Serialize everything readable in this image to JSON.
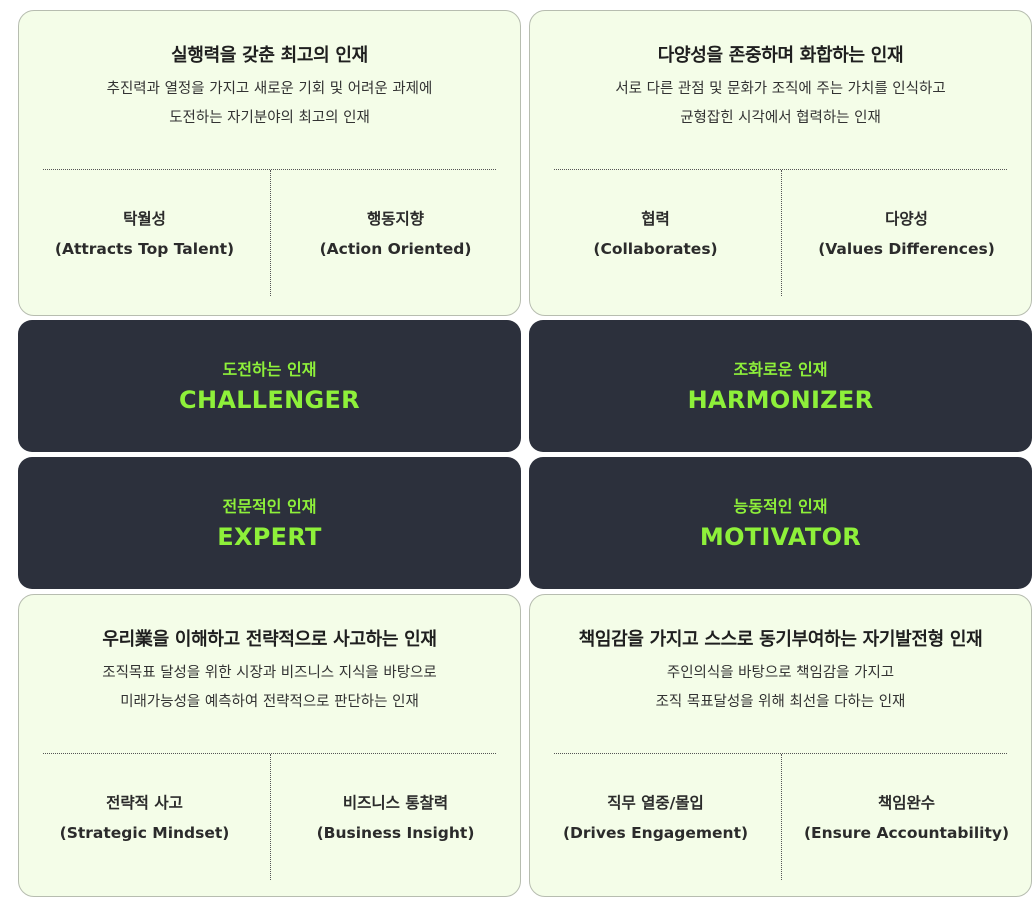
{
  "colors": {
    "card_background": "#f4fde8",
    "band_background": "#2c303c",
    "band_text": "#8ef03a"
  },
  "cards": [
    {
      "title": "실행력을 갖춘 최고의 인재",
      "desc_line1": "추진력과 열정을 가지고 새로운 기회 및 어려운 과제에",
      "desc_line2": "도전하는 자기분야의 최고의 인재",
      "left": {
        "ko": "탁월성",
        "en": "(Attracts Top Talent)"
      },
      "right": {
        "ko": "행동지향",
        "en": "(Action Oriented)"
      }
    },
    {
      "title": "다양성을 존중하며 화합하는 인재",
      "desc_line1": "서로 다른 관점 및 문화가 조직에 주는 가치를 인식하고",
      "desc_line2": "균형잡힌 시각에서 협력하는 인재",
      "left": {
        "ko": "협력",
        "en": "(Collaborates)"
      },
      "right": {
        "ko": "다양성",
        "en": "(Values Differences)"
      }
    },
    {
      "title": "우리業을 이해하고 전략적으로 사고하는 인재",
      "desc_line1": "조직목표 달성을 위한 시장과 비즈니스 지식을 바탕으로",
      "desc_line2": "미래가능성을 예측하여 전략적으로 판단하는 인재",
      "left": {
        "ko": "전략적 사고",
        "en": "(Strategic Mindset)"
      },
      "right": {
        "ko": "비즈니스 통찰력",
        "en": "(Business Insight)"
      }
    },
    {
      "title": "책임감을 가지고 스스로 동기부여하는 자기발전형 인재",
      "desc_line1": "주인의식을 바탕으로 책임감을 가지고",
      "desc_line2": "조직 목표달성을 위해 최선을 다하는 인재",
      "left": {
        "ko": "직무 열중/몰입",
        "en": "(Drives Engagement)"
      },
      "right": {
        "ko": "책임완수",
        "en": "(Ensure Accountability)"
      }
    }
  ],
  "bands": [
    {
      "ko": "도전하는 인재",
      "en": "CHALLENGER"
    },
    {
      "ko": "조화로운 인재",
      "en": "HARMONIZER"
    },
    {
      "ko": "전문적인 인재",
      "en": "EXPERT"
    },
    {
      "ko": "능동적인 인재",
      "en": "MOTIVATOR"
    }
  ]
}
